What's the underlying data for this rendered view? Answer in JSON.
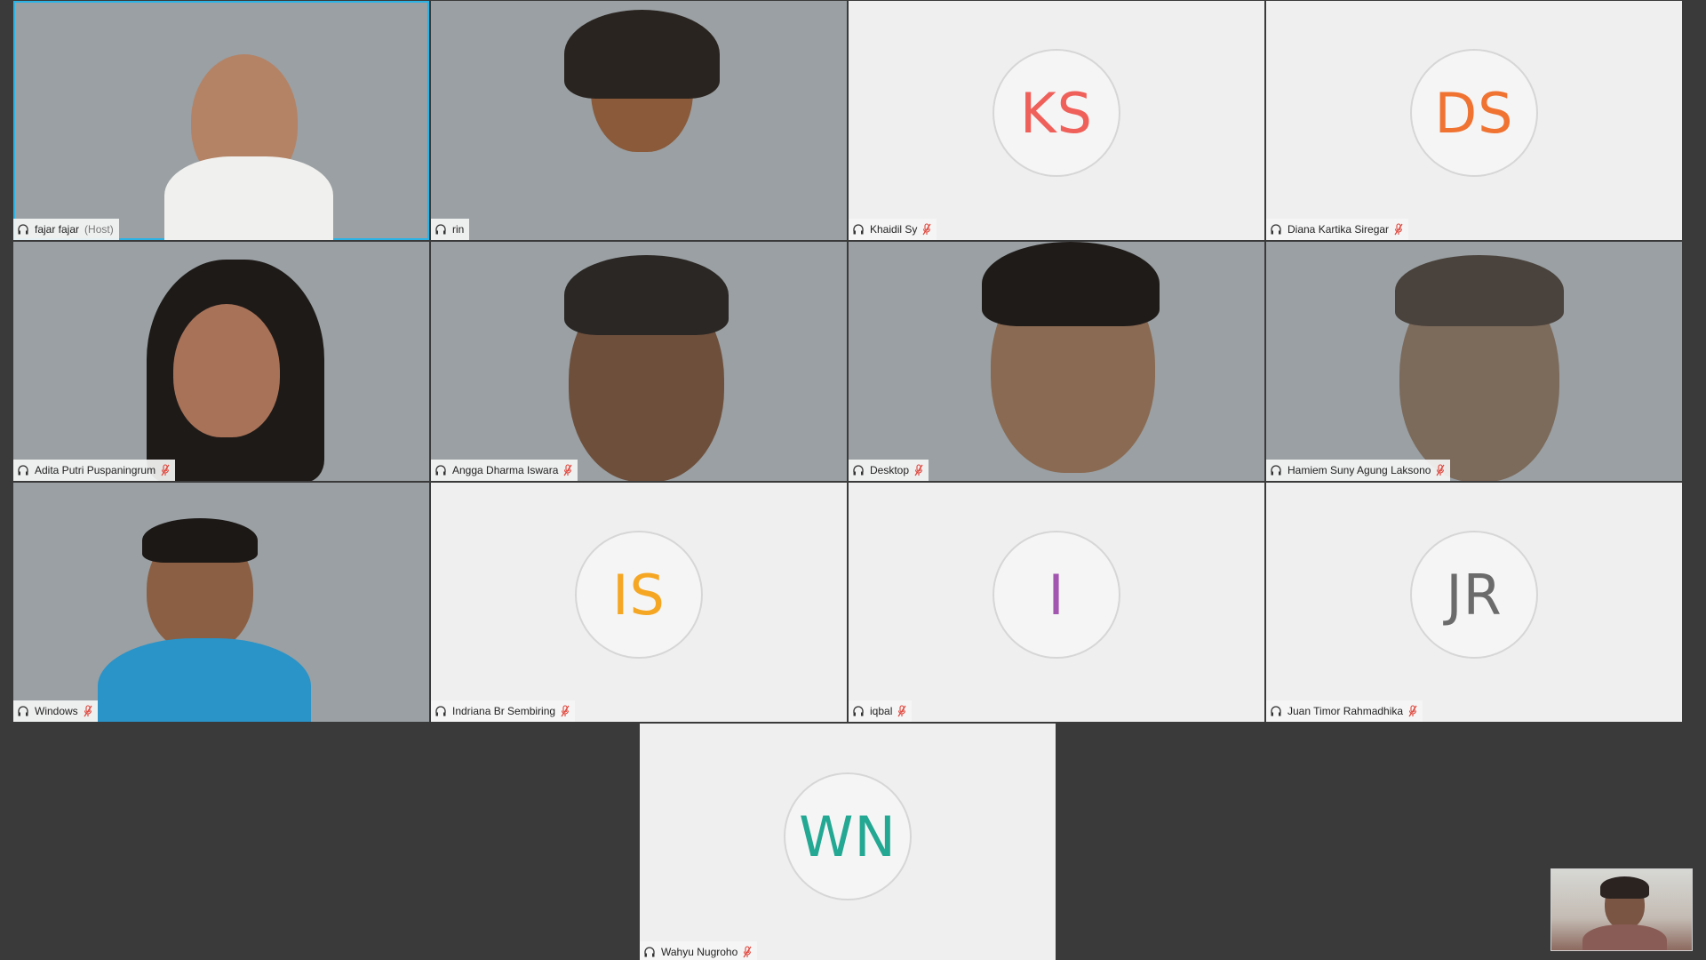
{
  "participants": [
    {
      "name": "fajar fajar",
      "suffix": "(Host)",
      "video": true,
      "muted": false,
      "active": true
    },
    {
      "name": "rin",
      "video": true,
      "muted": false
    },
    {
      "name": "Khaidil Sy",
      "initials": "KS",
      "video": false,
      "muted": true,
      "color": "#f0605a"
    },
    {
      "name": "Diana Kartika Siregar",
      "initials": "DS",
      "video": false,
      "muted": true,
      "color": "#f07332"
    },
    {
      "name": "Adita Putri Puspaningrum",
      "video": true,
      "muted": true
    },
    {
      "name": "Angga Dharma Iswara",
      "video": true,
      "muted": true
    },
    {
      "name": "Desktop",
      "video": true,
      "muted": true
    },
    {
      "name": "Hamiem Suny Agung Laksono",
      "video": true,
      "muted": true
    },
    {
      "name": "Windows",
      "video": true,
      "muted": true
    },
    {
      "name": "Indriana Br Sembiring",
      "initials": "IS",
      "video": false,
      "muted": true,
      "color": "#f5a623"
    },
    {
      "name": "iqbal",
      "initials": "I",
      "video": false,
      "muted": true,
      "color": "#a356b0"
    },
    {
      "name": "Juan Timor Rahmadhika",
      "initials": "JR",
      "video": false,
      "muted": true,
      "color": "#6b6b6b"
    },
    {
      "name": "Wahyu Nugroho",
      "initials": "WN",
      "video": false,
      "muted": true,
      "color": "#23a893"
    }
  ],
  "colors": {
    "active_border": "#2bb3e6",
    "mute_icon": "#e0443a",
    "background": "#3a3a3a"
  }
}
